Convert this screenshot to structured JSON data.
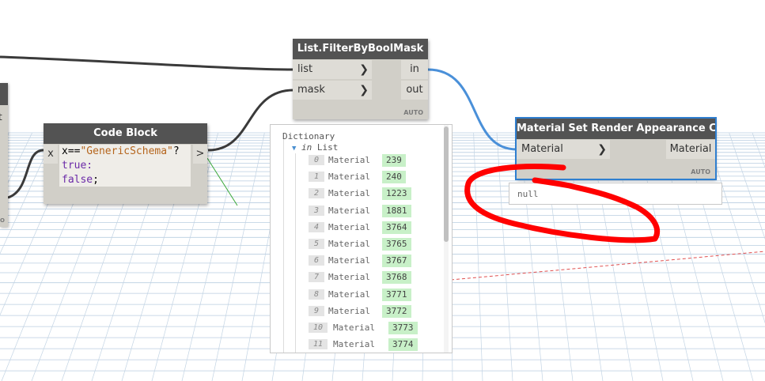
{
  "nodes": {
    "filter": {
      "title": "List.FilterByBoolMask",
      "inputs": [
        "list",
        "mask"
      ],
      "outputs": [
        "in",
        "out"
      ],
      "lacing": "AUTO"
    },
    "code_block": {
      "title": "Code Block",
      "port_x": "x",
      "port_out": ">",
      "code_line1_var": "x==",
      "code_line1_str": "\"GenericSchema\"",
      "code_line1_end": "?",
      "code_line2": "true:",
      "code_line3_kw": "false",
      "code_line3_end": ";"
    },
    "material": {
      "title": "Material Set Render Appearance Color",
      "input": "Material",
      "output": "Material",
      "lacing": "AUTO",
      "preview": "null"
    },
    "partial_left": {
      "port_label": "t",
      "lacing": "O"
    }
  },
  "preview": {
    "root": "Dictionary",
    "branch": "in",
    "branch_type": "List",
    "items": [
      {
        "index": "0",
        "label": "Material",
        "value": "239"
      },
      {
        "index": "1",
        "label": "Material",
        "value": "240"
      },
      {
        "index": "2",
        "label": "Material",
        "value": "1223"
      },
      {
        "index": "3",
        "label": "Material",
        "value": "1881"
      },
      {
        "index": "4",
        "label": "Material",
        "value": "3764"
      },
      {
        "index": "5",
        "label": "Material",
        "value": "3765"
      },
      {
        "index": "6",
        "label": "Material",
        "value": "3767"
      },
      {
        "index": "7",
        "label": "Material",
        "value": "3768"
      },
      {
        "index": "8",
        "label": "Material",
        "value": "3771"
      },
      {
        "index": "9",
        "label": "Material",
        "value": "3772"
      },
      {
        "index": "10",
        "label": "Material",
        "value": "3773"
      },
      {
        "index": "11",
        "label": "Material",
        "value": "3774"
      }
    ]
  },
  "colors": {
    "node_header": "#535353",
    "node_body": "#d1cfc8",
    "selected_border": "#2f7fd0",
    "wire_dark": "#3a3a3a",
    "wire_selected": "#4a90d9",
    "annotation": "#ff0000",
    "value_highlight": "#c8f0c8"
  }
}
